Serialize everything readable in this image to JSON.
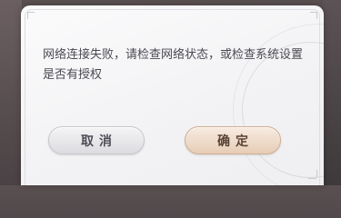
{
  "dialog": {
    "message": "网络连接失败，请检查网络状态，或检查系统设置是否有授权",
    "cancel_label": "取消",
    "confirm_label": "确定"
  },
  "colors": {
    "message_text": "#4a4a52",
    "cancel_bg": "#e8e8ec",
    "confirm_bg": "#efdcca"
  }
}
